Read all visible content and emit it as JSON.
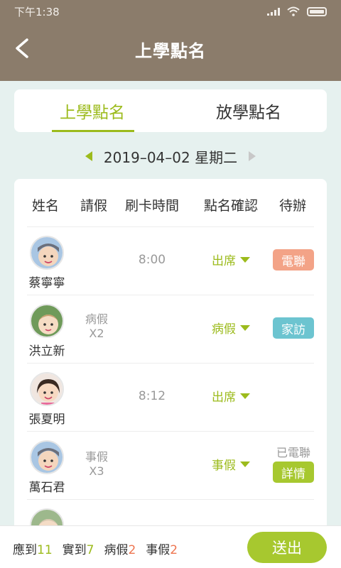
{
  "status_bar": {
    "time": "下午1:38"
  },
  "header": {
    "title": "上學點名"
  },
  "tabs": [
    {
      "label": "上學點名",
      "active": true
    },
    {
      "label": "放學點名",
      "active": false
    }
  ],
  "date": {
    "text": "2019–04–02 星期二"
  },
  "table": {
    "columns": [
      "姓名",
      "請假",
      "刷卡時間",
      "點名確認",
      "待辦"
    ],
    "rows": [
      {
        "name": "蔡寧寧",
        "leave_type": "",
        "leave_count": "",
        "time": "8:00",
        "status": "出席",
        "action": "電聯",
        "action_color": "#f3a387",
        "done_text": ""
      },
      {
        "name": "洪立新",
        "leave_type": "病假",
        "leave_count": "X2",
        "time": "",
        "status": "病假",
        "action": "家訪",
        "action_color": "#6cc4d0",
        "done_text": ""
      },
      {
        "name": "張夏明",
        "leave_type": "",
        "leave_count": "",
        "time": "8:12",
        "status": "出席",
        "action": "",
        "action_color": "",
        "done_text": ""
      },
      {
        "name": "萬石君",
        "leave_type": "事假",
        "leave_count": "X3",
        "time": "",
        "status": "事假",
        "action": "詳情",
        "action_color": "#a7c82f",
        "done_text": "已電聯"
      }
    ]
  },
  "summary": {
    "expected_label": "應到",
    "expected": "11",
    "actual_label": "實到",
    "actual": "7",
    "sick_label": "病假",
    "sick": "2",
    "personal_label": "事假",
    "personal": "2"
  },
  "submit_label": "送出",
  "colors": {
    "brand_bar": "#8b7c6b",
    "accent_green": "#9cbb1c",
    "count_red": "#ee7550"
  },
  "icons": {
    "back": "back-arrow-icon",
    "prev": "triangle-left-icon",
    "next": "triangle-right-icon"
  }
}
